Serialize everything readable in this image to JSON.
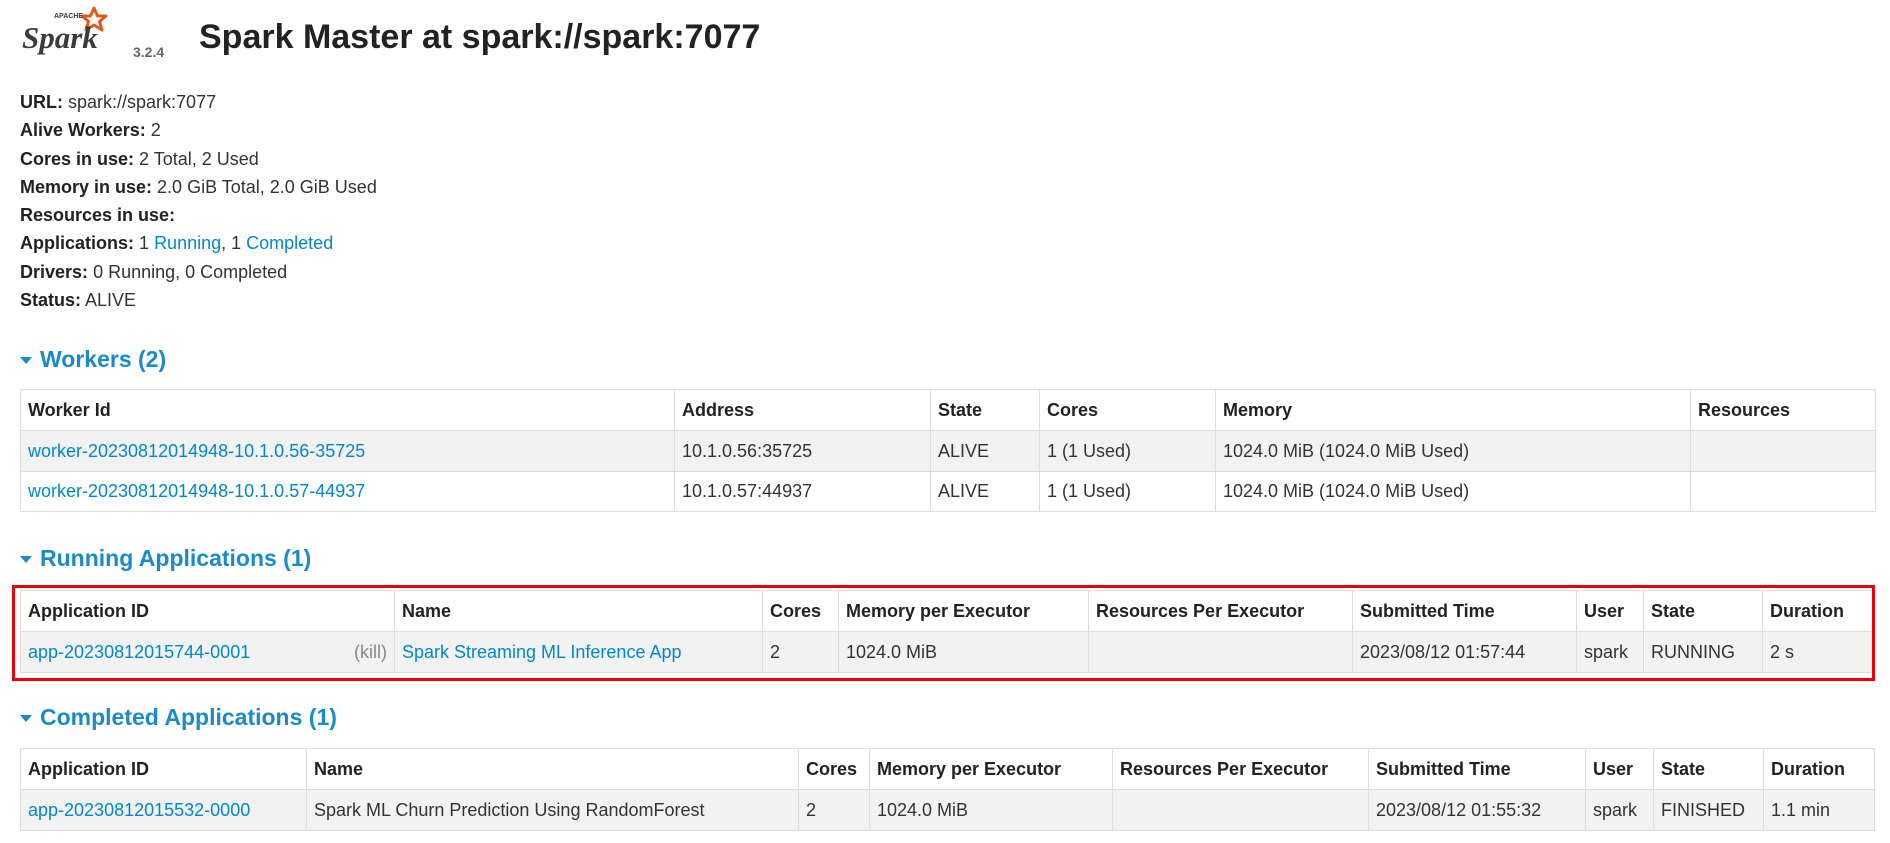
{
  "header": {
    "logo_alt": "Apache Spark",
    "version": "3.2.4",
    "title": "Spark Master at spark://spark:7077"
  },
  "summary": {
    "url_label": "URL:",
    "url_value": "spark://spark:7077",
    "workers_label": "Alive Workers:",
    "workers_value": "2",
    "cores_label": "Cores in use:",
    "cores_value": "2 Total, 2 Used",
    "memory_label": "Memory in use:",
    "memory_value": "2.0 GiB Total, 2.0 GiB Used",
    "resources_label": "Resources in use:",
    "apps_label": "Applications:",
    "apps_running_count": "1",
    "apps_running_link": "Running",
    "apps_sep": ", 1",
    "apps_completed_link": "Completed",
    "drivers_label": "Drivers:",
    "drivers_value": "0 Running, 0 Completed",
    "status_label": "Status:",
    "status_value": "ALIVE"
  },
  "workers": {
    "heading": "Workers (2)",
    "columns": [
      "Worker Id",
      "Address",
      "State",
      "Cores",
      "Memory",
      "Resources"
    ],
    "rows": [
      [
        "worker-20230812014948-10.1.0.56-35725",
        "10.1.0.56:35725",
        "ALIVE",
        "1 (1 Used)",
        "1024.0 MiB (1024.0 MiB Used)",
        ""
      ],
      [
        "worker-20230812014948-10.1.0.57-44937",
        "10.1.0.57:44937",
        "ALIVE",
        "1 (1 Used)",
        "1024.0 MiB (1024.0 MiB Used)",
        ""
      ]
    ]
  },
  "running": {
    "heading": "Running Applications (1)",
    "columns": [
      "Application ID",
      "Name",
      "Cores",
      "Memory per Executor",
      "Resources Per Executor",
      "Submitted Time",
      "User",
      "State",
      "Duration"
    ],
    "rows": [
      [
        "app-20230812015744-0001",
        "Spark Streaming ML Inference App",
        "2",
        "1024.0 MiB",
        "",
        "2023/08/12 01:57:44",
        "spark",
        "RUNNING",
        "2 s"
      ]
    ],
    "kill_label": "(kill)"
  },
  "completed": {
    "heading": "Completed Applications (1)",
    "columns": [
      "Application ID",
      "Name",
      "Cores",
      "Memory per Executor",
      "Resources Per Executor",
      "Submitted Time",
      "User",
      "State",
      "Duration"
    ],
    "rows": [
      [
        "app-20230812015532-0000",
        "Spark ML Churn Prediction Using RandomForest",
        "2",
        "1024.0 MiB",
        "",
        "2023/08/12 01:55:32",
        "spark",
        "FINISHED",
        "1.1 min"
      ]
    ]
  },
  "colors": {
    "link": "#0088cc",
    "section": "#1a8ac9",
    "highlight": "#e8000b",
    "logo_star": "#e25a1c"
  }
}
